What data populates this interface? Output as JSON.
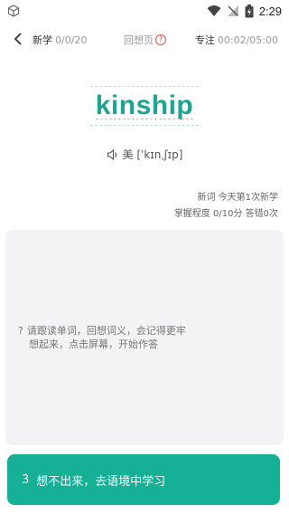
{
  "status": {
    "time": "2:29"
  },
  "header": {
    "mode_label": "新学",
    "mode_count": "0/0/20",
    "hint_label": "回想页",
    "focus_label": "专注",
    "focus_time": "00:02/05:00"
  },
  "word": {
    "text": "kinship",
    "phonetic": "美 [ˈkɪnˌʃɪp]"
  },
  "info": {
    "line1": "新词 今天第1次新学",
    "line2": "掌握程度 0/10分 答错0次"
  },
  "card": {
    "question_mark": "?",
    "line1": "请跟读单词，回想词义，会记得更牢",
    "line2": "想起来，点击屏幕，开始作答"
  },
  "action": {
    "number": "3",
    "label": "想不出来，去语境中学习"
  },
  "colors": {
    "accent": "#15b096",
    "word": "#1aa790",
    "help": "#e0534f"
  }
}
